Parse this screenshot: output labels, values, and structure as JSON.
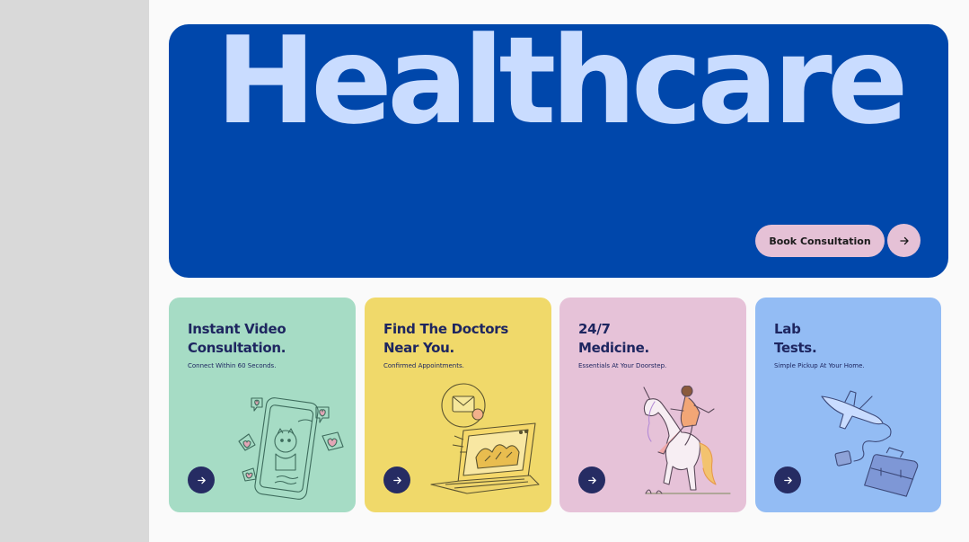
{
  "hero": {
    "title": "Healthcare",
    "cta_label": "Book Consultation",
    "cta_icon": "arrow-right-icon"
  },
  "cards": [
    {
      "title_line1": "Instant Video",
      "title_line2": "Consultation.",
      "subtitle": "Connect Within 60 Seconds.",
      "illustration": "phone-video-call-illustration",
      "icon": "arrow-right-icon"
    },
    {
      "title_line1": "Find The Doctors",
      "title_line2": "Near You.",
      "subtitle": "Confirmed Appointments.",
      "illustration": "laptop-mail-illustration",
      "icon": "arrow-right-icon"
    },
    {
      "title_line1": "24/7",
      "title_line2": "Medicine.",
      "subtitle": "Essentials At Your Doorstep.",
      "illustration": "unicorn-rider-illustration",
      "icon": "arrow-right-icon"
    },
    {
      "title_line1": "Lab",
      "title_line2": "Tests.",
      "subtitle": "Simple Pickup At Your Home.",
      "illustration": "airplane-briefcase-illustration",
      "icon": "arrow-right-icon"
    }
  ],
  "colors": {
    "hero_bg": "#0047ab",
    "hero_title": "#c9dcff",
    "cta_bg": "#e5c1d6",
    "card_green": "#a6dcc5",
    "card_yellow": "#f0d96a",
    "card_pink": "#e6c2d8",
    "card_blue": "#93bcf4",
    "navy": "#262c63"
  }
}
